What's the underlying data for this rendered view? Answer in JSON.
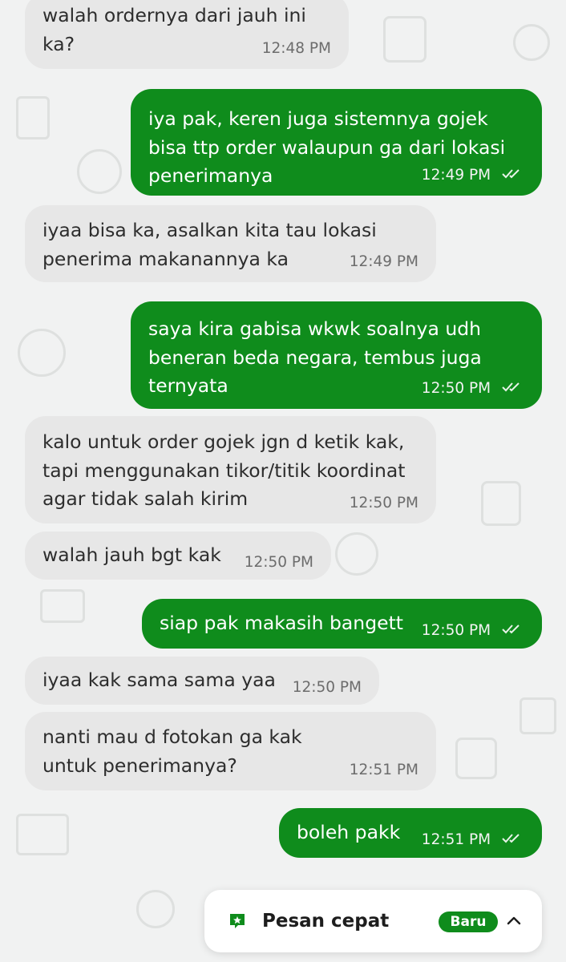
{
  "messages": [
    {
      "dir": "in",
      "text": "walah ordernya dari jauh ini ka?",
      "time": "12:48 PM"
    },
    {
      "dir": "out",
      "text": "iya pak, keren juga sistemnya gojek bisa ttp order walaupun ga dari lokasi penerimanya",
      "time": "12:49 PM"
    },
    {
      "dir": "in",
      "text": "iyaa bisa ka, asalkan kita tau lokasi penerima makanannya ka",
      "time": "12:49 PM"
    },
    {
      "dir": "out",
      "text": "saya kira gabisa wkwk soalnya udh beneran beda negara, tembus juga ternyata",
      "time": "12:50 PM"
    },
    {
      "dir": "in",
      "text": "kalo untuk order gojek jgn d ketik kak, tapi menggunakan tikor/titik koordinat agar tidak salah kirim",
      "time": "12:50 PM"
    },
    {
      "dir": "in",
      "text": "walah jauh bgt kak",
      "time": "12:50 PM"
    },
    {
      "dir": "out",
      "text": "siap pak makasih bangett",
      "time": "12:50 PM"
    },
    {
      "dir": "in",
      "text": "iyaa kak sama sama yaa",
      "time": "12:50 PM"
    },
    {
      "dir": "in",
      "text": "nanti mau d fotokan ga kak untuk penerimanya?",
      "time": "12:51 PM"
    },
    {
      "dir": "out",
      "text": "boleh pakk",
      "time": "12:51 PM"
    }
  ],
  "quick_reply": {
    "label": "Pesan cepat",
    "badge": "Baru",
    "icon": "quick-message-icon"
  },
  "colors": {
    "outgoing_bubble": "#0f8c1c",
    "incoming_bubble": "#e7e7e7",
    "background": "#f1f2f2"
  }
}
